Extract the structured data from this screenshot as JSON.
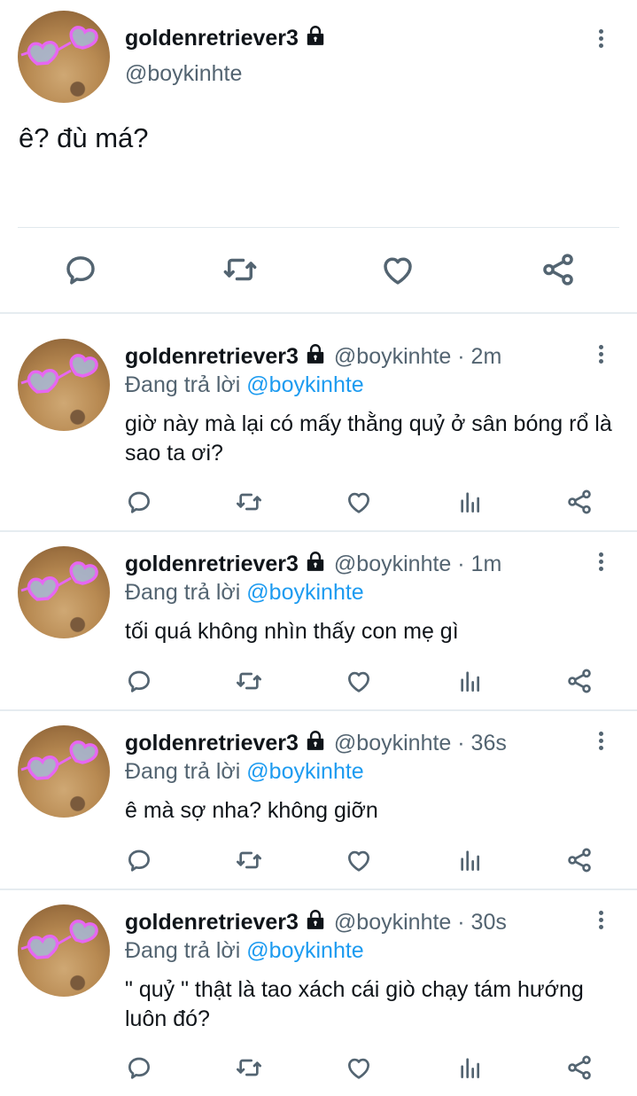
{
  "main_tweet": {
    "display_name": "goldenretriever3",
    "handle": "@boykinhte",
    "text": "ê? đù má?",
    "actions": [
      "reply-icon",
      "retweet-icon",
      "like-icon",
      "share-icon"
    ]
  },
  "replies": [
    {
      "display_name": "goldenretriever3",
      "meta": "@boykinhte · 2m",
      "replying_prefix": "Đang trả lời",
      "replying_to": "@boykinhte",
      "text": "giờ này mà lại có mấy thằng quỷ ở sân bóng rổ là sao ta ơi?"
    },
    {
      "display_name": "goldenretriever3",
      "meta": "@boykinhte · 1m",
      "replying_prefix": "Đang trả lời",
      "replying_to": "@boykinhte",
      "text": "tối quá không nhìn thấy con mẹ gì"
    },
    {
      "display_name": "goldenretriever3",
      "meta": "@boykinhte · 36s",
      "replying_prefix": "Đang trả lời",
      "replying_to": "@boykinhte",
      "text": "ê mà sợ nha? không giỡn"
    },
    {
      "display_name": "goldenretriever3",
      "meta": "@boykinhte · 30s",
      "replying_prefix": "Đang trả lời",
      "replying_to": "@boykinhte",
      "text": "\" quỷ \" thật là tao xách cái giò chạy tám hướng luôn đó?"
    }
  ],
  "colors": {
    "text": "#0f1419",
    "secondary": "#536471",
    "mention": "#1d9bf0",
    "divider": "#e6ecf0"
  }
}
